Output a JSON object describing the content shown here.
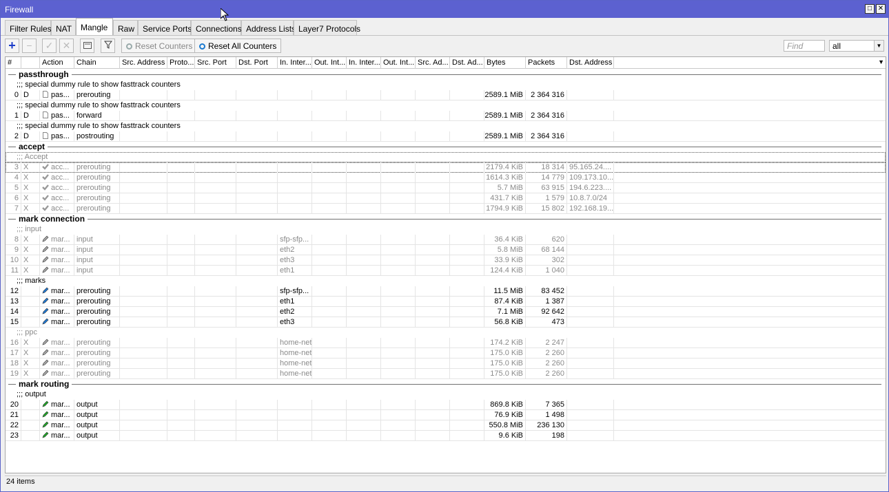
{
  "window": {
    "title": "Firewall"
  },
  "tabs": [
    {
      "label": "Filter Rules",
      "active": false
    },
    {
      "label": "NAT",
      "active": false
    },
    {
      "label": "Mangle",
      "active": true
    },
    {
      "label": "Raw",
      "active": false
    },
    {
      "label": "Service Ports",
      "active": false
    },
    {
      "label": "Connections",
      "active": false
    },
    {
      "label": "Address Lists",
      "active": false
    },
    {
      "label": "Layer7 Protocols",
      "active": false
    }
  ],
  "toolbar": {
    "reset_counters": "Reset Counters",
    "reset_all_counters": "Reset All Counters",
    "find_placeholder": "Find",
    "filter_value": "all"
  },
  "columns": [
    "#",
    "",
    "Action",
    "Chain",
    "Src. Address",
    "Proto...",
    "Src. Port",
    "Dst. Port",
    "In. Inter...",
    "Out. Int...",
    "In. Inter...",
    "Out. Int...",
    "Src. Ad...",
    "Dst. Ad...",
    "Bytes",
    "Packets",
    "Dst. Address"
  ],
  "rows": [
    {
      "type": "group",
      "label": "passthrough"
    },
    {
      "type": "comment",
      "text": ";;; special dummy rule to show fasttrack counters",
      "disabled": false
    },
    {
      "type": "rule",
      "num": "0",
      "flag": "D",
      "icon": "page",
      "action": "pas...",
      "chain": "prerouting",
      "in": "",
      "bytes": "2589.1 MiB",
      "packets": "2 364 316",
      "dst": "",
      "disabled": false
    },
    {
      "type": "comment",
      "text": ";;; special dummy rule to show fasttrack counters",
      "disabled": false
    },
    {
      "type": "rule",
      "num": "1",
      "flag": "D",
      "icon": "page",
      "action": "pas...",
      "chain": "forward",
      "in": "",
      "bytes": "2589.1 MiB",
      "packets": "2 364 316",
      "dst": "",
      "disabled": false
    },
    {
      "type": "comment",
      "text": ";;; special dummy rule to show fasttrack counters",
      "disabled": false
    },
    {
      "type": "rule",
      "num": "2",
      "flag": "D",
      "icon": "page",
      "action": "pas...",
      "chain": "postrouting",
      "in": "",
      "bytes": "2589.1 MiB",
      "packets": "2 364 316",
      "dst": "",
      "disabled": false
    },
    {
      "type": "group",
      "label": "accept"
    },
    {
      "type": "comment",
      "text": ";;; Accept",
      "disabled": true,
      "selected": true
    },
    {
      "type": "rule",
      "num": "3",
      "flag": "X",
      "icon": "check",
      "action": "acc...",
      "chain": "prerouting",
      "in": "",
      "bytes": "2179.4 KiB",
      "packets": "18 314",
      "dst": "95.165.24....",
      "disabled": true,
      "selected": true
    },
    {
      "type": "rule",
      "num": "4",
      "flag": "X",
      "icon": "check",
      "action": "acc...",
      "chain": "prerouting",
      "in": "",
      "bytes": "1614.3 KiB",
      "packets": "14 779",
      "dst": "109.173.10...",
      "disabled": true
    },
    {
      "type": "rule",
      "num": "5",
      "flag": "X",
      "icon": "check",
      "action": "acc...",
      "chain": "prerouting",
      "in": "",
      "bytes": "5.7 MiB",
      "packets": "63 915",
      "dst": "194.6.223....",
      "disabled": true
    },
    {
      "type": "rule",
      "num": "6",
      "flag": "X",
      "icon": "check",
      "action": "acc...",
      "chain": "prerouting",
      "in": "",
      "bytes": "431.7 KiB",
      "packets": "1 579",
      "dst": "10.8.7.0/24",
      "disabled": true
    },
    {
      "type": "rule",
      "num": "7",
      "flag": "X",
      "icon": "check",
      "action": "acc...",
      "chain": "prerouting",
      "in": "",
      "bytes": "1794.9 KiB",
      "packets": "15 802",
      "dst": "192.168.19...",
      "disabled": true
    },
    {
      "type": "group",
      "label": "mark connection"
    },
    {
      "type": "comment",
      "text": ";;; input",
      "disabled": true
    },
    {
      "type": "rule",
      "num": "8",
      "flag": "X",
      "icon": "pen-gray",
      "action": "mar...",
      "chain": "input",
      "in": "sfp-sfp...",
      "bytes": "36.4 KiB",
      "packets": "620",
      "dst": "",
      "disabled": true
    },
    {
      "type": "rule",
      "num": "9",
      "flag": "X",
      "icon": "pen-gray",
      "action": "mar...",
      "chain": "input",
      "in": "eth2",
      "bytes": "5.8 MiB",
      "packets": "68 144",
      "dst": "",
      "disabled": true
    },
    {
      "type": "rule",
      "num": "10",
      "flag": "X",
      "icon": "pen-gray",
      "action": "mar...",
      "chain": "input",
      "in": "eth3",
      "bytes": "33.9 KiB",
      "packets": "302",
      "dst": "",
      "disabled": true
    },
    {
      "type": "rule",
      "num": "11",
      "flag": "X",
      "icon": "pen-gray",
      "action": "mar...",
      "chain": "input",
      "in": "eth1",
      "bytes": "124.4 KiB",
      "packets": "1 040",
      "dst": "",
      "disabled": true
    },
    {
      "type": "comment",
      "text": ";;; marks",
      "disabled": false
    },
    {
      "type": "rule",
      "num": "12",
      "flag": "",
      "icon": "pen-blue",
      "action": "mar...",
      "chain": "prerouting",
      "in": "sfp-sfp...",
      "bytes": "11.5 MiB",
      "packets": "83 452",
      "dst": "",
      "disabled": false
    },
    {
      "type": "rule",
      "num": "13",
      "flag": "",
      "icon": "pen-blue",
      "action": "mar...",
      "chain": "prerouting",
      "in": "eth1",
      "bytes": "87.4 KiB",
      "packets": "1 387",
      "dst": "",
      "disabled": false
    },
    {
      "type": "rule",
      "num": "14",
      "flag": "",
      "icon": "pen-blue",
      "action": "mar...",
      "chain": "prerouting",
      "in": "eth2",
      "bytes": "7.1 MiB",
      "packets": "92 642",
      "dst": "",
      "disabled": false
    },
    {
      "type": "rule",
      "num": "15",
      "flag": "",
      "icon": "pen-blue",
      "action": "mar...",
      "chain": "prerouting",
      "in": "eth3",
      "bytes": "56.8 KiB",
      "packets": "473",
      "dst": "",
      "disabled": false
    },
    {
      "type": "comment",
      "text": ";;; ppc",
      "disabled": true
    },
    {
      "type": "rule",
      "num": "16",
      "flag": "X",
      "icon": "pen-gray",
      "action": "mar...",
      "chain": "prerouting",
      "in": "home-net",
      "bytes": "174.2 KiB",
      "packets": "2 247",
      "dst": "",
      "disabled": true
    },
    {
      "type": "rule",
      "num": "17",
      "flag": "X",
      "icon": "pen-gray",
      "action": "mar...",
      "chain": "prerouting",
      "in": "home-net",
      "bytes": "175.0 KiB",
      "packets": "2 260",
      "dst": "",
      "disabled": true
    },
    {
      "type": "rule",
      "num": "18",
      "flag": "X",
      "icon": "pen-gray",
      "action": "mar...",
      "chain": "prerouting",
      "in": "home-net",
      "bytes": "175.0 KiB",
      "packets": "2 260",
      "dst": "",
      "disabled": true
    },
    {
      "type": "rule",
      "num": "19",
      "flag": "X",
      "icon": "pen-gray",
      "action": "mar...",
      "chain": "prerouting",
      "in": "home-net",
      "bytes": "175.0 KiB",
      "packets": "2 260",
      "dst": "",
      "disabled": true
    },
    {
      "type": "group",
      "label": "mark routing"
    },
    {
      "type": "comment",
      "text": ";;; output",
      "disabled": false
    },
    {
      "type": "rule",
      "num": "20",
      "flag": "",
      "icon": "pen-green",
      "action": "mar...",
      "chain": "output",
      "in": "",
      "bytes": "869.8 KiB",
      "packets": "7 365",
      "dst": "",
      "disabled": false
    },
    {
      "type": "rule",
      "num": "21",
      "flag": "",
      "icon": "pen-green",
      "action": "mar...",
      "chain": "output",
      "in": "",
      "bytes": "76.9 KiB",
      "packets": "1 498",
      "dst": "",
      "disabled": false
    },
    {
      "type": "rule",
      "num": "22",
      "flag": "",
      "icon": "pen-green",
      "action": "mar...",
      "chain": "output",
      "in": "",
      "bytes": "550.8 MiB",
      "packets": "236 130",
      "dst": "",
      "disabled": false
    },
    {
      "type": "rule",
      "num": "23",
      "flag": "",
      "icon": "pen-green",
      "action": "mar...",
      "chain": "output",
      "in": "",
      "bytes": "9.6 KiB",
      "packets": "198",
      "dst": "",
      "disabled": false
    }
  ],
  "status": {
    "items": "24 items"
  },
  "colors": {
    "titlebar": "#5c61d0",
    "pen_blue": "#1e78d4",
    "pen_green": "#22a52a",
    "pen_gray": "#a8a8a8"
  }
}
